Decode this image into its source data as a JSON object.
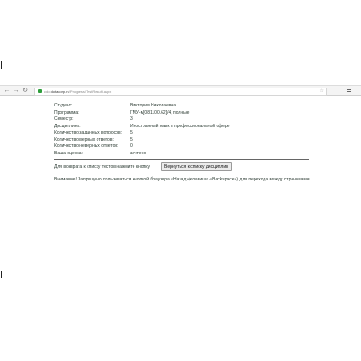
{
  "browser": {
    "back_icon": "arrow-left-icon",
    "forward_icon": "arrow-right-icon",
    "reload_icon": "reload-icon",
    "url_host": "cdo.",
    "url_domain": "dotacorp.ru",
    "url_path": "/Progress/TestResult.aspx"
  },
  "result": {
    "rows": [
      {
        "label": "Студент:",
        "value": "Виктория Николаевна"
      },
      {
        "label": "Программа:",
        "value": "ГМУ-м[081100.62]/4, полные"
      },
      {
        "label": "Семестр:",
        "value": "3"
      },
      {
        "label": "Дисциплина:",
        "value": "Иностранный язык в профессиональной сфере"
      },
      {
        "label": "Количество заданных вопросов:",
        "value": "5"
      },
      {
        "label": "Количество верных ответов:",
        "value": "5"
      },
      {
        "label": "Количество неверных ответов:",
        "value": "0"
      },
      {
        "label": "Ваша оценка:",
        "value": "зачтено"
      }
    ]
  },
  "back": {
    "text": "Для возврата к списку тестов нажмите кнопку",
    "button_label": "Вернуться к списку дисциплин"
  },
  "warning": "Внимание! Запрещено пользоваться кнопкой браузера «Назад»(клавиша «Backspace») для перехода между страницами."
}
